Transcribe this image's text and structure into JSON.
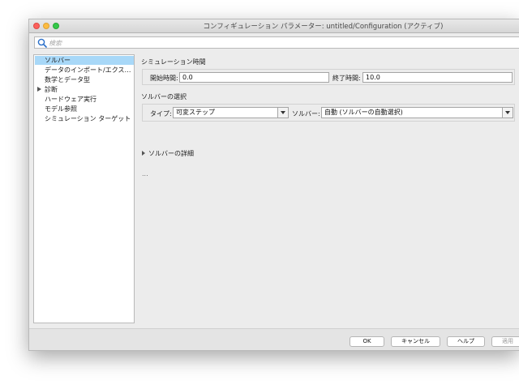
{
  "window": {
    "title": "コンフィギュレーション パラメーター: untitled/Configuration (アクティブ)"
  },
  "search": {
    "placeholder": "検索"
  },
  "sidebar": {
    "items": [
      {
        "label": "ソルバー",
        "selected": true,
        "expandable": false
      },
      {
        "label": "データのインポート/エクス…",
        "selected": false,
        "expandable": false
      },
      {
        "label": "数学とデータ型",
        "selected": false,
        "expandable": false
      },
      {
        "label": "診断",
        "selected": false,
        "expandable": true
      },
      {
        "label": "ハードウェア実行",
        "selected": false,
        "expandable": false
      },
      {
        "label": "モデル参照",
        "selected": false,
        "expandable": false
      },
      {
        "label": "シミュレーション ターゲット",
        "selected": false,
        "expandable": false
      }
    ]
  },
  "sim_time": {
    "section_title": "シミュレーション時間",
    "start_label": "開始時間:",
    "start_value": "0.0",
    "stop_label": "終了時間:",
    "stop_value": "10.0"
  },
  "solver_select": {
    "section_title": "ソルバーの選択",
    "type_label": "タイプ:",
    "type_value": "可変ステップ",
    "solver_label": "ソルバー:",
    "solver_value": "自動 (ソルバーの自動選択)"
  },
  "solver_details": {
    "label": "ソルバーの詳細"
  },
  "ellipsis": "...",
  "footer": {
    "ok": "OK",
    "cancel": "キャンセル",
    "help": "ヘルプ",
    "apply": "適用"
  }
}
